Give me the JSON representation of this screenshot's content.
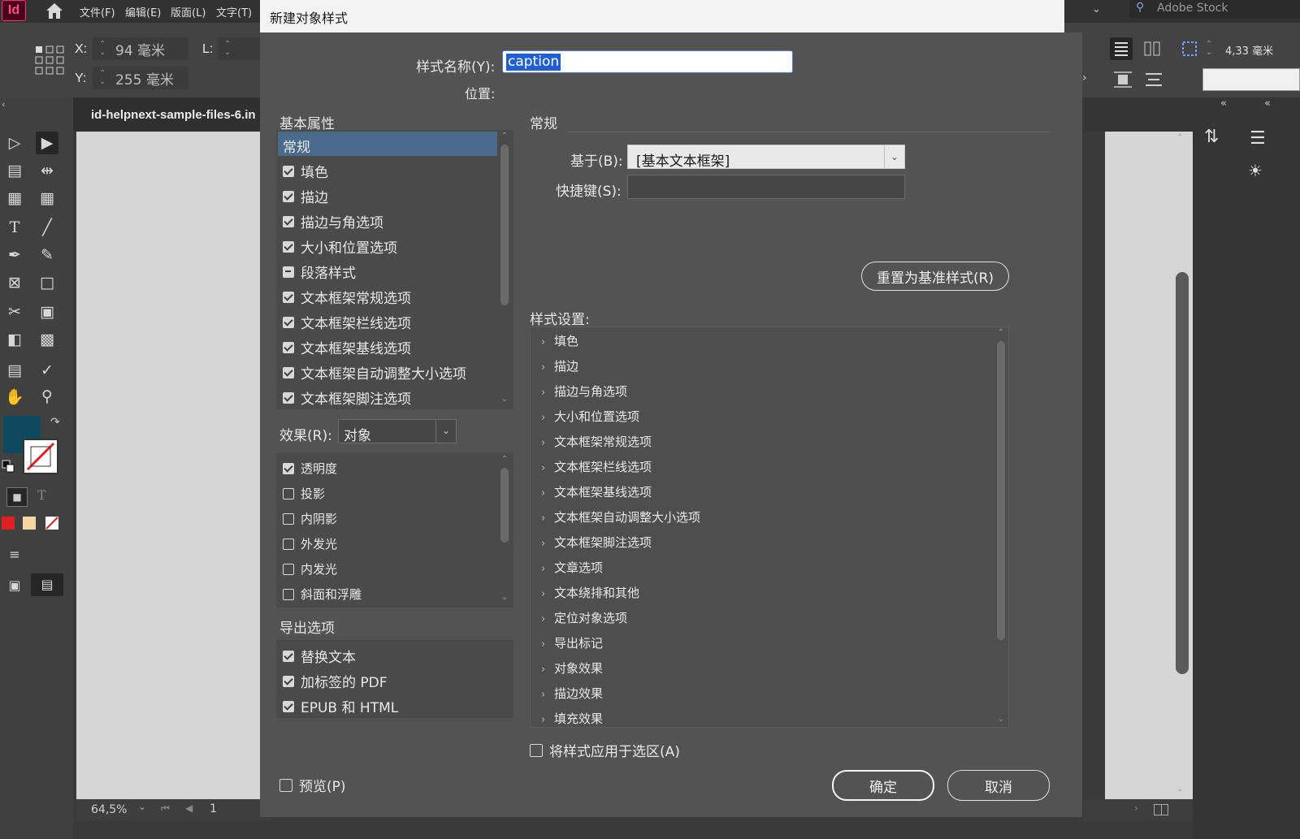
{
  "app": {
    "logo": "Id",
    "menus": [
      "文件(F)",
      "编辑(E)",
      "版面(L)",
      "文字(T)"
    ],
    "stock_search": "Adobe Stock",
    "x_label": "X:",
    "x_value": "94 毫米",
    "y_label": "Y:",
    "y_value": "255 毫米",
    "l_label": "L:",
    "right_value": "4,33 毫米",
    "document_tab": "id-helpnext-sample-files-6.in",
    "zoom": "64,5%",
    "page_number": "1"
  },
  "dialog": {
    "title": "新建对象样式",
    "style_name_label": "样式名称(Y):",
    "style_name_value": "caption",
    "location_label": "位置:",
    "basic_attributes_heading": "基本属性",
    "basic_attributes": [
      {
        "label": "常规",
        "state": "selected"
      },
      {
        "label": "填色",
        "state": "checked"
      },
      {
        "label": "描边",
        "state": "checked"
      },
      {
        "label": "描边与角选项",
        "state": "checked"
      },
      {
        "label": "大小和位置选项",
        "state": "checked"
      },
      {
        "label": "段落样式",
        "state": "mixed"
      },
      {
        "label": "文本框架常规选项",
        "state": "checked"
      },
      {
        "label": "文本框架栏线选项",
        "state": "checked"
      },
      {
        "label": "文本框架基线选项",
        "state": "checked"
      },
      {
        "label": "文本框架自动调整大小选项",
        "state": "checked"
      },
      {
        "label": "文本框架脚注选项",
        "state": "checked"
      }
    ],
    "effects_label": "效果(R):",
    "effects_value": "对象",
    "effects": [
      {
        "label": "透明度",
        "checked": true
      },
      {
        "label": "投影",
        "checked": false
      },
      {
        "label": "内阴影",
        "checked": false
      },
      {
        "label": "外发光",
        "checked": false
      },
      {
        "label": "内发光",
        "checked": false
      },
      {
        "label": "斜面和浮雕",
        "checked": false
      }
    ],
    "export_heading": "导出选项",
    "export_options": [
      {
        "label": "替换文本",
        "checked": true
      },
      {
        "label": "加标签的 PDF",
        "checked": true
      },
      {
        "label": "EPUB 和 HTML",
        "checked": true
      }
    ],
    "preview_label": "预览(P)",
    "general_heading": "常规",
    "based_on_label": "基于(B):",
    "based_on_value": "[基本文本框架]",
    "shortcut_label": "快捷键(S):",
    "shortcut_value": "",
    "reset_button": "重置为基准样式(R)",
    "style_settings_label": "样式设置:",
    "style_settings": [
      "填色",
      "描边",
      "描边与角选项",
      "大小和位置选项",
      "文本框架常规选项",
      "文本框架栏线选项",
      "文本框架基线选项",
      "文本框架自动调整大小选项",
      "文本框架脚注选项",
      "文章选项",
      "文本绕排和其他",
      "定位对象选项",
      "导出标记",
      "对象效果",
      "描边效果",
      "填充效果"
    ],
    "apply_to_selection_label": "将样式应用于选区(A)",
    "ok_button": "确定",
    "cancel_button": "取消"
  },
  "colors": {
    "fill_swatch": "#0d4a60",
    "selection_highlight": "#4b6b8c",
    "dialog_bg": "#535353"
  }
}
